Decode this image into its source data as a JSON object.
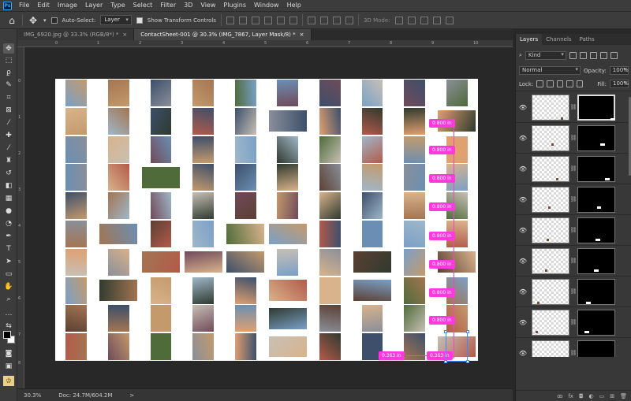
{
  "app": {
    "logo": "Ps"
  },
  "menu": [
    "File",
    "Edit",
    "Image",
    "Layer",
    "Type",
    "Select",
    "Filter",
    "3D",
    "View",
    "Plugins",
    "Window",
    "Help"
  ],
  "options": {
    "auto_select_label": "Auto-Select:",
    "auto_select_value": "Layer",
    "show_transform_label": "Show Transform Controls",
    "mode_3d": "3D Mode:"
  },
  "tabs": [
    {
      "label": "IMG_6920.jpg @ 33.3% (RGB/8*) *",
      "close": "×"
    },
    {
      "label": "ContactSheet-001 @ 30.3% (IMG_7867, Layer Mask/8) *",
      "close": "×"
    }
  ],
  "rulers": {
    "top": [
      "0",
      "1",
      "2",
      "3",
      "4",
      "5",
      "6",
      "7",
      "8",
      "9",
      "10"
    ],
    "left": [
      "0",
      "1",
      "2",
      "3",
      "4",
      "5",
      "6",
      "7",
      "8"
    ]
  },
  "measurements": {
    "vertical": [
      "0.800 in",
      "0.800 in",
      "0.800 in",
      "0.800 in",
      "0.800 in",
      "0.800 in",
      "0.800 in",
      "0.800 in"
    ],
    "horizontal": [
      "0.363 in",
      "0.363 in"
    ]
  },
  "status": {
    "zoom": "30.3%",
    "doc": "Doc: 24.7M/604.2M",
    "arrow": ">"
  },
  "layers_panel": {
    "tabs": [
      "Layers",
      "Channels",
      "Paths"
    ],
    "filter": "Kind",
    "blend_mode": "Normal",
    "opacity_label": "Opacity:",
    "opacity_value": "100%",
    "lock_label": "Lock:",
    "fill_label": "Fill:",
    "fill_value": "100%",
    "footer_icons": [
      "link-icon",
      "fx-icon",
      "mask-icon",
      "adjustment-icon",
      "folder-icon",
      "new-layer-icon",
      "trash-icon"
    ],
    "footer_text": [
      "ꝏ",
      "fx",
      "◘",
      "◐",
      "▭",
      "⊞",
      "🗑"
    ]
  },
  "colors": {
    "accent": "#31a8ff",
    "guide": "#ff39de",
    "selection": "#3d8cff"
  }
}
